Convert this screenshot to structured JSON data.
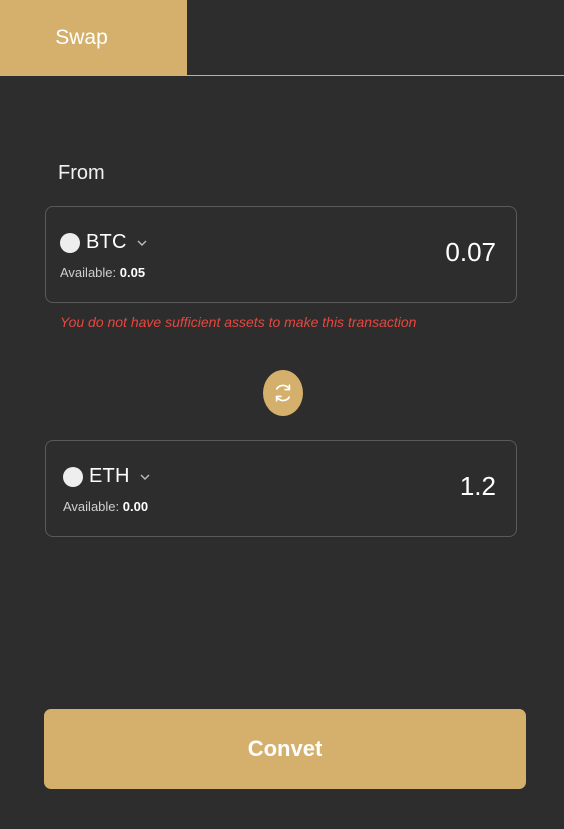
{
  "tabs": {
    "swap_label": "Swap"
  },
  "from": {
    "label": "From",
    "token": "BTC",
    "available_label": "Available:",
    "available_value": "0.05",
    "amount": "0.07",
    "error": "You do not have sufficient assets to make this transaction"
  },
  "to": {
    "token": "ETH",
    "available_label": "Available:",
    "available_value": "0.00",
    "amount": "1.2"
  },
  "actions": {
    "convert_label": "Convet"
  },
  "colors": {
    "background": "#2d2d2d",
    "accent_gold": "#d4b06c",
    "error_red": "#e8463e",
    "card_border": "#5a5a5a"
  },
  "icons": {
    "swap_direction": "refresh-swap-icon",
    "dropdown": "chevron-down-icon",
    "token": "token-circle-icon"
  }
}
